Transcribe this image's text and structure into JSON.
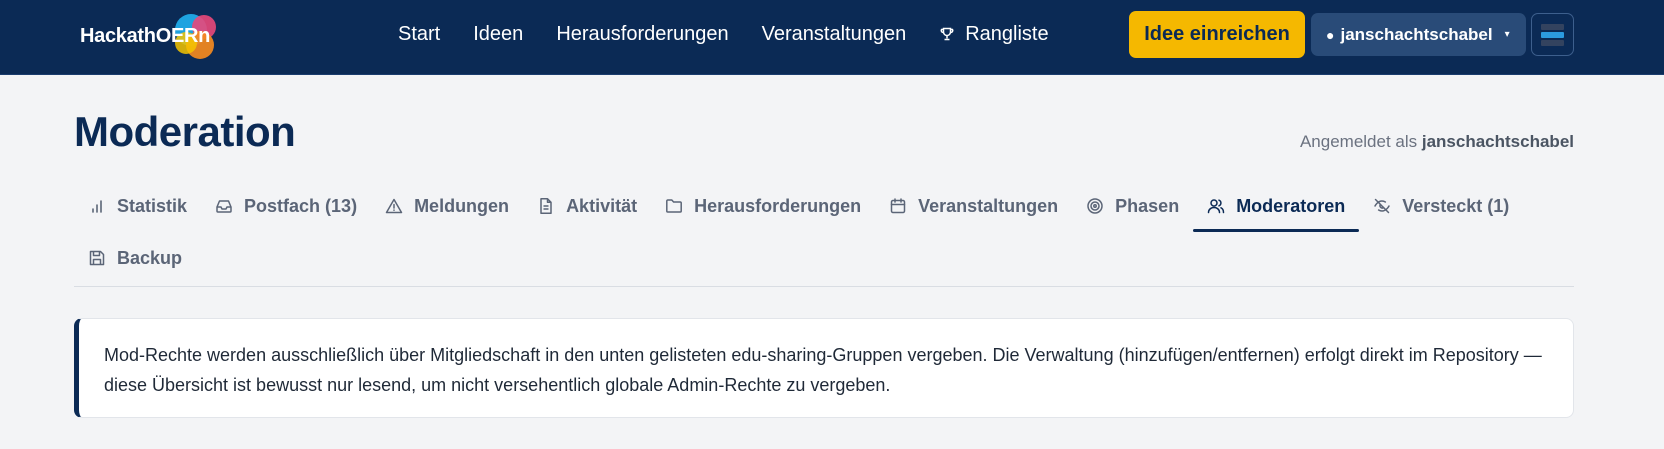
{
  "brand": {
    "name": "HackathOERn"
  },
  "nav": {
    "links": [
      {
        "label": "Start"
      },
      {
        "label": "Ideen"
      },
      {
        "label": "Herausforderungen"
      },
      {
        "label": "Veranstaltungen"
      },
      {
        "label": "Rangliste",
        "icon": "trophy-icon"
      }
    ],
    "submit_label": "Idee einreichen",
    "user": {
      "bullet": "●",
      "name": "janschachtschabel",
      "caret": "▾"
    }
  },
  "header": {
    "title": "Moderation",
    "logged_in_prefix": "Angemeldet als",
    "logged_in_user": "janschachtschabel"
  },
  "tabs": [
    {
      "label": "Statistik",
      "icon": "bar-chart-icon"
    },
    {
      "label": "Postfach (13)",
      "icon": "inbox-icon"
    },
    {
      "label": "Meldungen",
      "icon": "warning-icon"
    },
    {
      "label": "Aktivität",
      "icon": "document-icon"
    },
    {
      "label": "Herausforderungen",
      "icon": "folder-icon"
    },
    {
      "label": "Veranstaltungen",
      "icon": "calendar-icon"
    },
    {
      "label": "Phasen",
      "icon": "target-icon"
    },
    {
      "label": "Moderatoren",
      "icon": "users-icon",
      "active": true
    },
    {
      "label": "Versteckt (1)",
      "icon": "eye-off-icon"
    },
    {
      "label": "Backup",
      "icon": "save-icon"
    }
  ],
  "info": {
    "text": "Mod-Rechte werden ausschließlich über Mitgliedschaft in den unten gelisteten edu-sharing-Gruppen vergeben. Die Verwaltung (hinzufügen/entfernen) erfolgt direkt im Repository — diese Übersicht ist bewusst nur lesend, um nicht versehentlich globale Admin-Rechte zu vergeben."
  },
  "colors": {
    "navbar": "#0b2a55",
    "accent_button": "#f5b800",
    "page_background": "#f3f4f6"
  }
}
